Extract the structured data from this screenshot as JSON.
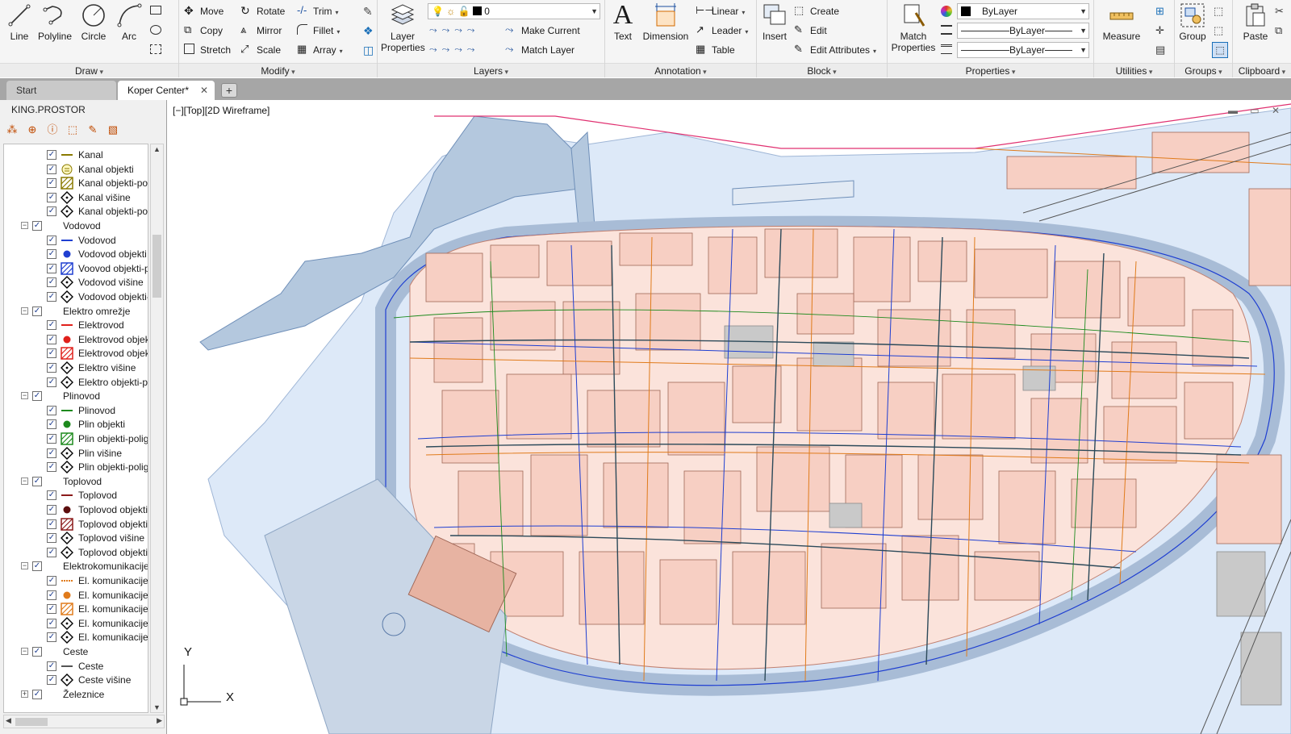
{
  "ribbon": {
    "draw": {
      "title": "Draw",
      "line": "Line",
      "polyline": "Polyline",
      "circle": "Circle",
      "arc": "Arc"
    },
    "modify": {
      "title": "Modify",
      "move": "Move",
      "rotate": "Rotate",
      "trim": "Trim",
      "copy": "Copy",
      "mirror": "Mirror",
      "fillet": "Fillet",
      "stretch": "Stretch",
      "scale": "Scale",
      "array": "Array"
    },
    "layers": {
      "title": "Layers",
      "layer_properties": "Layer Properties",
      "current_layer": "0",
      "make_current": "Make Current",
      "match_layer": "Match Layer"
    },
    "annotation": {
      "title": "Annotation",
      "text": "Text",
      "dimension": "Dimension",
      "linear": "Linear",
      "leader": "Leader",
      "table": "Table"
    },
    "block": {
      "title": "Block",
      "insert": "Insert",
      "create": "Create",
      "edit": "Edit",
      "edit_attributes": "Edit Attributes"
    },
    "properties": {
      "title": "Properties",
      "match_properties": "Match Properties",
      "color": "ByLayer",
      "linetype": "ByLayer",
      "lineweight": "ByLayer"
    },
    "utilities": {
      "title": "Utilities",
      "measure": "Measure"
    },
    "groups": {
      "title": "Groups",
      "group": "Group"
    },
    "clipboard": {
      "title": "Clipboard",
      "paste": "Paste"
    }
  },
  "tabs": {
    "start": "Start",
    "active": "Koper Center*"
  },
  "sidebar": {
    "title": "KING.PROSTOR",
    "tree": [
      {
        "label": "Kanal",
        "level": 2,
        "sym": "line",
        "color": "#8a7a00"
      },
      {
        "label": "Kanal objekti",
        "level": 2,
        "sym": "circle-e",
        "color": "#8a7a00"
      },
      {
        "label": "Kanal objekti-poli",
        "level": 2,
        "sym": "hatch",
        "color": "#8a7a00"
      },
      {
        "label": "Kanal višine",
        "level": 2,
        "sym": "diamond",
        "color": "#000000"
      },
      {
        "label": "Kanal objekti-poli",
        "level": 2,
        "sym": "diamond",
        "color": "#000000"
      },
      {
        "label": "Vodovod",
        "level": 1
      },
      {
        "label": "Vodovod",
        "level": 2,
        "sym": "line",
        "color": "#1f3fd1"
      },
      {
        "label": "Vodovod objekti",
        "level": 2,
        "sym": "dot",
        "color": "#1f3fd1"
      },
      {
        "label": "Voovod objekti-p",
        "level": 2,
        "sym": "hatch",
        "color": "#1f3fd1"
      },
      {
        "label": "Vodovod višine",
        "level": 2,
        "sym": "diamond",
        "color": "#000000"
      },
      {
        "label": "Vodovod objekti-",
        "level": 2,
        "sym": "diamond",
        "color": "#000000"
      },
      {
        "label": "Elektro omrežje",
        "level": 1
      },
      {
        "label": "Elektrovod",
        "level": 2,
        "sym": "line",
        "color": "#e0201b"
      },
      {
        "label": "Elektrovod objekt",
        "level": 2,
        "sym": "dot",
        "color": "#e0201b"
      },
      {
        "label": "Elektrovod objekt",
        "level": 2,
        "sym": "hatch",
        "color": "#e0201b"
      },
      {
        "label": "Elektro višine",
        "level": 2,
        "sym": "diamond",
        "color": "#000000"
      },
      {
        "label": "Elektro objekti-pc",
        "level": 2,
        "sym": "diamond",
        "color": "#000000"
      },
      {
        "label": "Plinovod",
        "level": 1
      },
      {
        "label": "Plinovod",
        "level": 2,
        "sym": "line",
        "color": "#1d8a1d"
      },
      {
        "label": "Plin objekti",
        "level": 2,
        "sym": "dot",
        "color": "#1d8a1d"
      },
      {
        "label": "Plin objekti-polig",
        "level": 2,
        "sym": "hatch",
        "color": "#1d8a1d"
      },
      {
        "label": "Plin višine",
        "level": 2,
        "sym": "diamond",
        "color": "#000000"
      },
      {
        "label": "Plin objekti-polig",
        "level": 2,
        "sym": "diamond",
        "color": "#000000"
      },
      {
        "label": "Toplovod",
        "level": 1
      },
      {
        "label": "Toplovod",
        "level": 2,
        "sym": "line",
        "color": "#8b1a1a"
      },
      {
        "label": "Toplovod objekti",
        "level": 2,
        "sym": "dot",
        "color": "#5c0e0e"
      },
      {
        "label": "Toplovod objekti-",
        "level": 2,
        "sym": "hatch",
        "color": "#8b1a1a"
      },
      {
        "label": "Toplovod višine",
        "level": 2,
        "sym": "diamond",
        "color": "#000000"
      },
      {
        "label": "Toplovod objekti-",
        "level": 2,
        "sym": "diamond",
        "color": "#000000"
      },
      {
        "label": "Elektrokomunikacije",
        "level": 1
      },
      {
        "label": "El. komunikacije",
        "level": 2,
        "sym": "dashline",
        "color": "#e07b1b"
      },
      {
        "label": "El. komunikacije c",
        "level": 2,
        "sym": "dot",
        "color": "#e07b1b"
      },
      {
        "label": "El. komunikacije c",
        "level": 2,
        "sym": "hatch",
        "color": "#e07b1b"
      },
      {
        "label": "El. komunikacije v",
        "level": 2,
        "sym": "diamond",
        "color": "#000000"
      },
      {
        "label": "El. komunikacije c",
        "level": 2,
        "sym": "diamond",
        "color": "#000000"
      },
      {
        "label": "Ceste",
        "level": 1
      },
      {
        "label": "Ceste",
        "level": 2,
        "sym": "line",
        "color": "#555555"
      },
      {
        "label": "Ceste višine",
        "level": 2,
        "sym": "diamond",
        "color": "#000000"
      },
      {
        "label": "Železnice",
        "level": 1,
        "collapsed": true
      }
    ]
  },
  "viewport": {
    "label": "[−][Top][2D Wireframe]",
    "ucs_y": "Y",
    "ucs_x": "X"
  },
  "colors": {
    "building": "#f7cfc3",
    "building_edge": "#c08070",
    "sea": "#dde9f8",
    "road": "#b4c8de",
    "water_line": "#1f3fd1",
    "gas_line": "#1d8a1d",
    "telecom_line": "#e07b1b"
  }
}
